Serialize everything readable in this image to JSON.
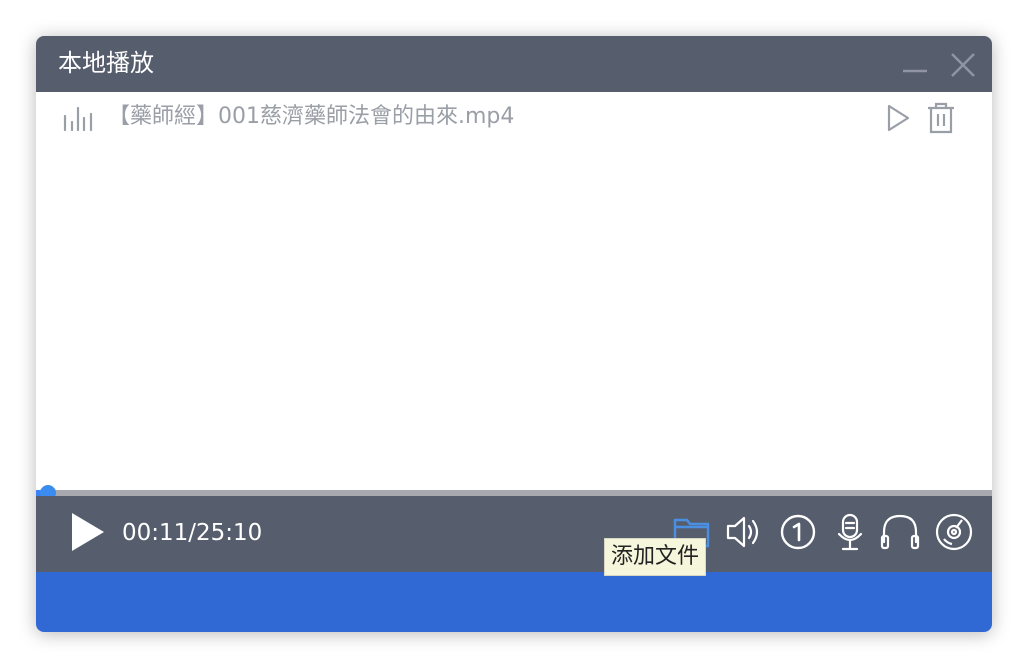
{
  "window": {
    "title": "本地播放"
  },
  "playlist": {
    "items": [
      {
        "filename": "【藥師經】001慈濟藥師法會的由來.mp4"
      }
    ]
  },
  "player": {
    "time_display": "00:11/25:10",
    "progress_fraction": 0.0073
  },
  "tooltip": {
    "text": "添加文件"
  },
  "colors": {
    "titlebar": "#565d6d",
    "accent": "#3b8cf0",
    "bottom_bar": "#3169d4",
    "folder_icon": "#4a90e2"
  },
  "icons": {
    "minimize": "minimize-icon",
    "close": "close-icon",
    "equalizer": "equalizer-icon",
    "row_play": "play-icon",
    "row_delete": "trash-icon",
    "play": "play-icon",
    "add_file": "folder-icon",
    "volume": "volume-icon",
    "single_loop": "one-circle-icon",
    "mic": "microphone-icon",
    "headphones": "headphones-icon",
    "disc": "disc-icon"
  }
}
